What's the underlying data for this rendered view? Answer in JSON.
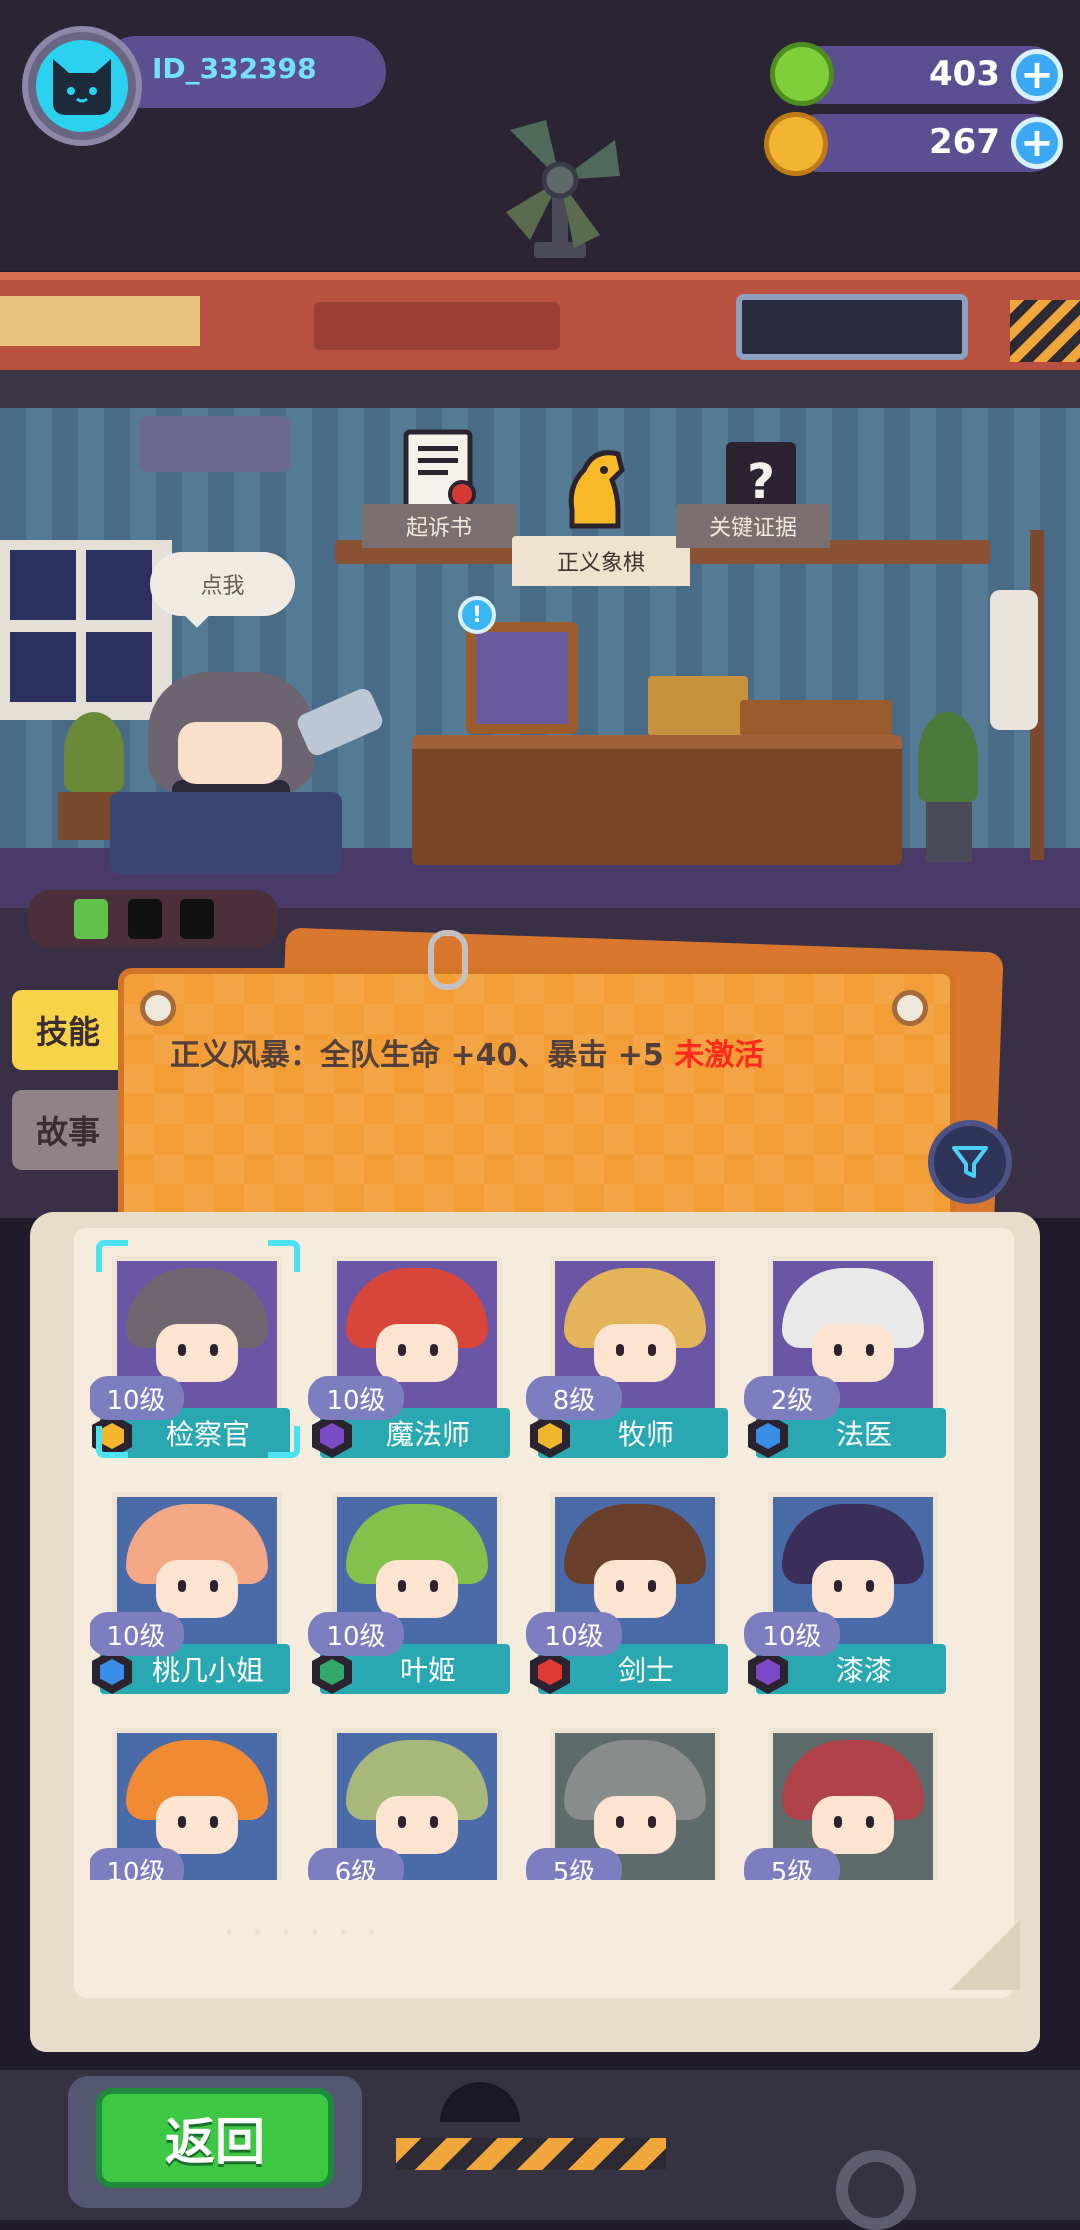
{
  "player": {
    "id": "ID_332398"
  },
  "resources": [
    {
      "name": "green-gem",
      "value": "403",
      "color": "#7fcf3a"
    },
    {
      "name": "gold-planet-coin",
      "value": "267",
      "color": "#f3b52f"
    }
  ],
  "room": {
    "bubble": "点我",
    "shelf_tabs": [
      "起诉书",
      "正义象棋",
      "关键证据"
    ],
    "selected_shelf_tab": "正义象棋"
  },
  "side_tabs": {
    "skill": "技能",
    "story": "故事"
  },
  "skill": {
    "description": "正义风暴：全队生命 +40、暴击 +5",
    "status": "未激活"
  },
  "characters": [
    {
      "name": "检察官",
      "level": "10级",
      "badge_color": "#f2b62e",
      "hair": "#6f6672",
      "bg": "#6a56a4",
      "selected": true
    },
    {
      "name": "魔法师",
      "level": "10级",
      "badge_color": "#7c4cc8",
      "hair": "#d8453b",
      "bg": "#6a56a4"
    },
    {
      "name": "牧师",
      "level": "8级",
      "badge_color": "#f2b62e",
      "hair": "#e3b45a",
      "bg": "#6a56a4"
    },
    {
      "name": "法医",
      "level": "2级",
      "badge_color": "#3a8ee8",
      "hair": "#e9e9e9",
      "bg": "#6a56a4"
    },
    {
      "name": "桃几小姐",
      "level": "10级",
      "badge_color": "#3a8ee8",
      "hair": "#f3a784",
      "bg": "#4b6aa8"
    },
    {
      "name": "叶姬",
      "level": "10级",
      "badge_color": "#2fa86a",
      "hair": "#84c04c",
      "bg": "#4b6aa8"
    },
    {
      "name": "剑士",
      "level": "10级",
      "badge_color": "#e03a32",
      "hair": "#6a3f2c",
      "bg": "#4b6aa8"
    },
    {
      "name": "漆漆",
      "level": "10级",
      "badge_color": "#7c4cc8",
      "hair": "#3a2f5a",
      "bg": "#4b6aa8"
    },
    {
      "name": "",
      "level": "10级",
      "badge_color": "#f2b62e",
      "hair": "#f08b33",
      "bg": "#4b6aa8"
    },
    {
      "name": "",
      "level": "6级",
      "badge_color": "#2fa86a",
      "hair": "#a8b87a",
      "bg": "#4b6aa8"
    },
    {
      "name": "",
      "level": "5级",
      "badge_color": "#3a8ee8",
      "hair": "#888c8a",
      "bg": "#5d6b6a"
    },
    {
      "name": "",
      "level": "5级",
      "badge_color": "#e03a32",
      "hair": "#b0434a",
      "bg": "#5d6b6a"
    }
  ],
  "book_footer": "· · · · · ·",
  "back_button": "返回"
}
